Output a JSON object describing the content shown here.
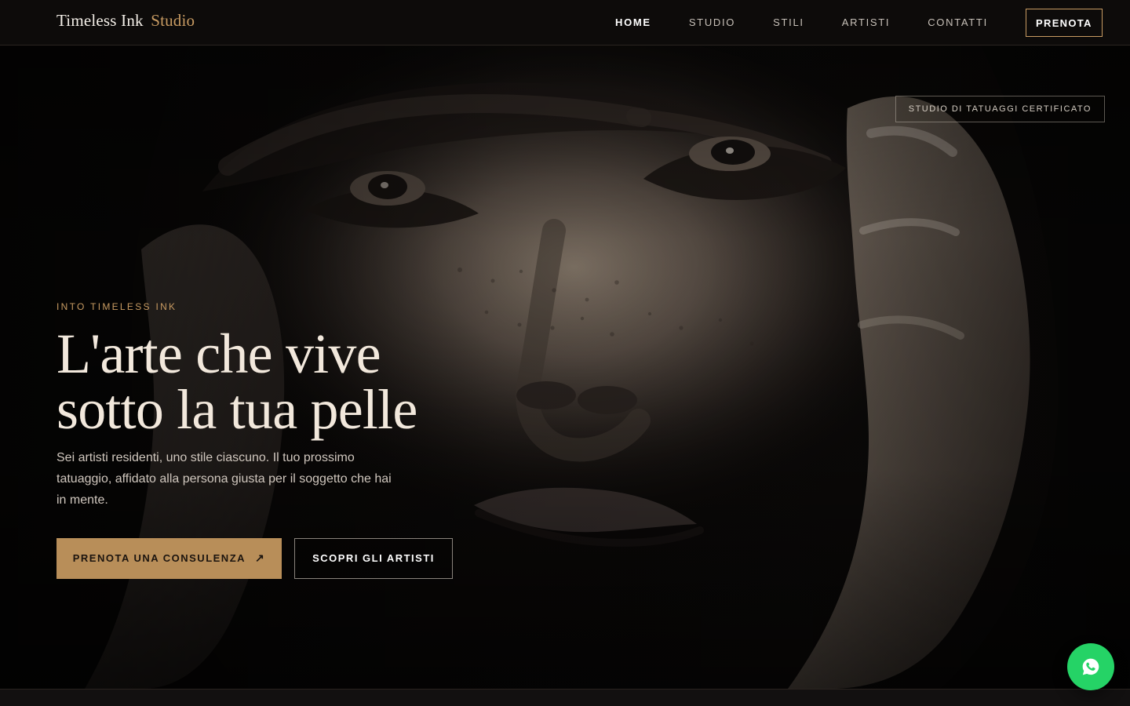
{
  "header": {
    "brand_primary": "Timeless Ink",
    "brand_accent": "Studio",
    "nav": {
      "home": "HOME",
      "studio": "STUDIO",
      "stili": "STILI",
      "artisti": "ARTISTI",
      "contatti": "CONTATTI",
      "cta": "PRENOTA"
    }
  },
  "hero": {
    "badge": "STUDIO DI TATUAGGI CERTIFICATO",
    "eyebrow": "INTO TIMELESS INK",
    "headline_line1": "L'arte che vive",
    "headline_line2": "sotto la tua pelle",
    "description": "Sei artisti residenti, uno stile ciascuno. Il tuo prossimo tatuaggio, affidato alla persona giusta per il soggetto che hai in mente.",
    "primary_button": "PRENOTA UNA CONSULENZA",
    "primary_button_icon": "arrow-up-right-icon",
    "secondary_button": "SCOPRI GLI ARTISTI",
    "image_icon": "woman-portrait-image"
  },
  "floating": {
    "whatsapp_icon": "whatsapp-icon"
  },
  "colors": {
    "accent": "#c89b62",
    "button_gold": "#b88e59",
    "whatsapp_green": "#25d366"
  }
}
